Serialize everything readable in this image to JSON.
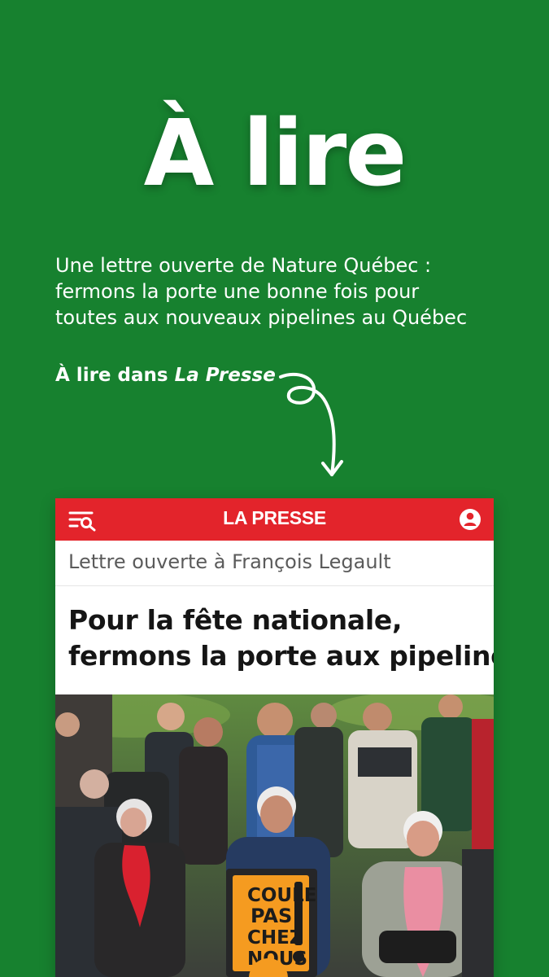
{
  "heading": {
    "title": "À lire"
  },
  "intro": {
    "lines": [
      "Une lettre ouverte de Nature Québec :",
      "fermons la porte une bonne fois pour",
      "toutes aux nouveaux pipelines au Québec"
    ]
  },
  "cta": {
    "prefix": "À lire dans ",
    "publication": "La Presse"
  },
  "article_card": {
    "brand": "LA PRESSE",
    "kicker": "Lettre ouverte à François Legault",
    "headline_lines": [
      "Pour la fête nationale,",
      "fermons la porte aux pipelines"
    ],
    "icons": {
      "menu": "menu-search-icon",
      "profile": "user-profile-icon"
    },
    "protest_sign_lines": [
      "COULE",
      "PAS",
      "CHEZ",
      "NOUS"
    ]
  },
  "colors": {
    "background": "#17812f",
    "brand_red": "#e3242b",
    "sign_orange": "#f59b20"
  }
}
